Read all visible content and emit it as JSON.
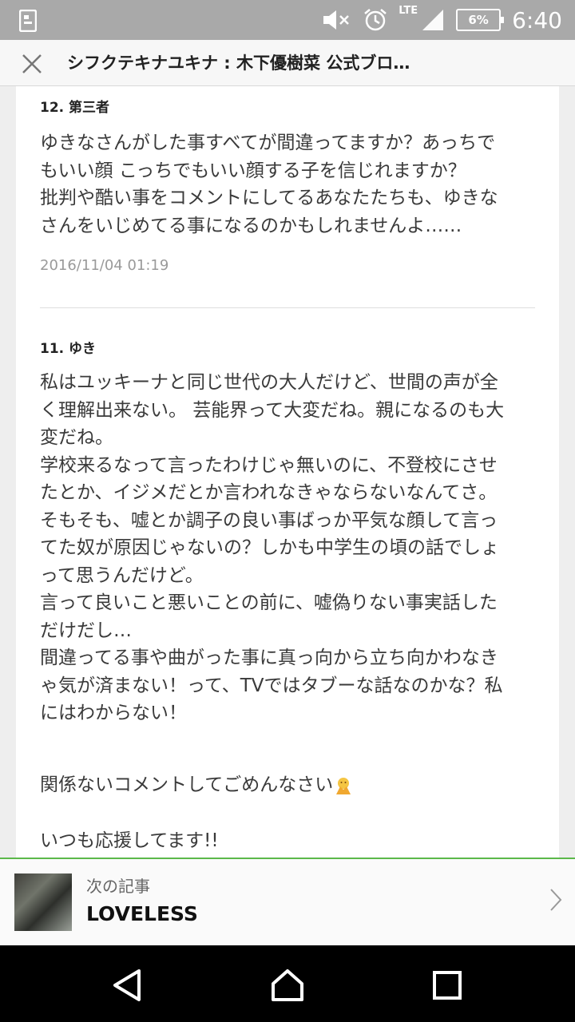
{
  "status_bar": {
    "time": "6:40",
    "battery": "6%",
    "network": "LTE",
    "icons": [
      "notification-icon",
      "mute-icon",
      "alarm-icon",
      "signal-icon",
      "battery-icon"
    ]
  },
  "title_bar": {
    "title": "シフクテキナユキナ : 木下優樹菜 公式ブロ…",
    "close_icon": "close-icon"
  },
  "comments": [
    {
      "header": "12. 第三者",
      "body": "ゆきなさんがした事すべてが間違ってますか？あっちで\nもいい顔 こっちでもいい顔する子を信じれますか？\n批判や酷い事をコメントにしてるあなたたちも、ゆきな\nさんをいじめてる事になるのかもしれませんよ……",
      "date": "2016/11/04 01:19"
    },
    {
      "header": "11. ゆき",
      "body_lines": "私はユッキーナと同じ世代の大人だけど、世間の声が全\nく理解出来ない。 芸能界って大変だね。親になるのも大\n変だね。\n学校来るなって言ったわけじゃ無いのに、不登校にさせ\nたとか、イジメだとか言われなきゃならないなんてさ。\nそもそも、嘘とか調子の良い事ばっか平気な顔して言っ\nてた奴が原因じゃないの？しかも中学生の頃の話でしょ\nって思うんだけど。\n言って良いこと悪いことの前に、嘘偽りない事実話した\nだけだし…\n間違ってる事や曲がった事に真っ向から立ち向かわなき\nゃ気が済まない！って、TVではタブーな話なのかな？私\nにはわからない！",
      "apology": "関係ないコメントしてごめんなさい",
      "closing": "いつも応援してます!!",
      "emoji": "praying-emoji-icon"
    }
  ],
  "next_article": {
    "label": "次の記事",
    "title": "LOVELESS",
    "arrow_icon": "chevron-right-icon"
  },
  "nav_bar": {
    "buttons": [
      "back-icon",
      "home-icon",
      "recents-icon"
    ]
  },
  "colors": {
    "status_bar": "#a9a9a9",
    "accent_border": "#5bb84a",
    "nav_bar": "#000000"
  }
}
